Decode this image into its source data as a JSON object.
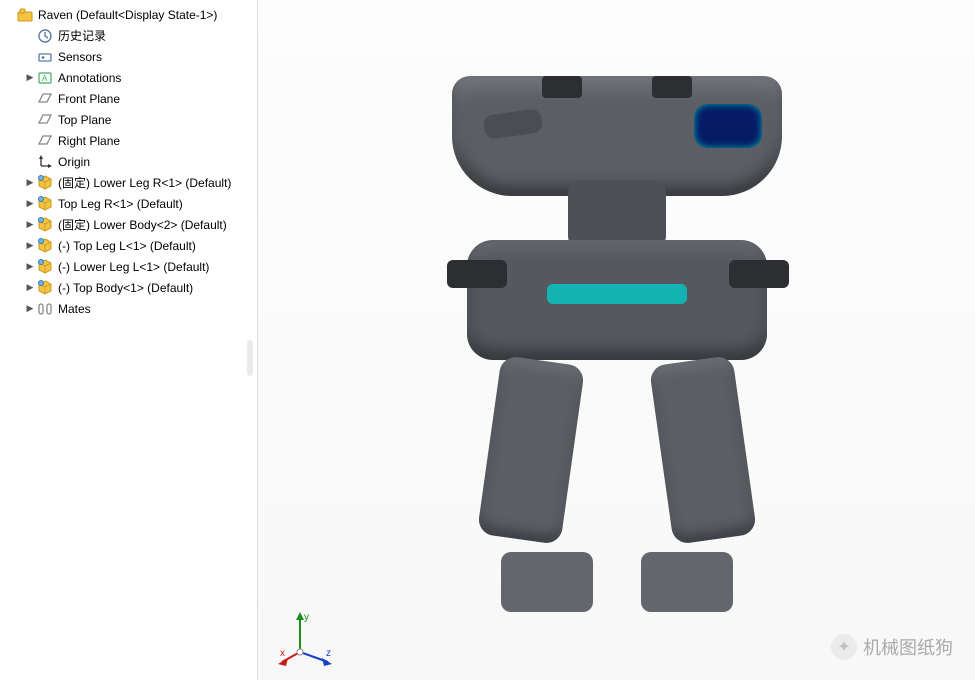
{
  "tree": {
    "root": {
      "label": "Raven  (Default<Display State-1>)"
    },
    "items": [
      {
        "label": "历史记录",
        "icon": "history-icon",
        "indent": 1,
        "arrow": ""
      },
      {
        "label": "Sensors",
        "icon": "sensor-icon",
        "indent": 1,
        "arrow": ""
      },
      {
        "label": "Annotations",
        "icon": "annotation-icon",
        "indent": 1,
        "arrow": "▶"
      },
      {
        "label": "Front Plane",
        "icon": "plane-icon",
        "indent": 1,
        "arrow": ""
      },
      {
        "label": "Top Plane",
        "icon": "plane-icon",
        "indent": 1,
        "arrow": ""
      },
      {
        "label": "Right Plane",
        "icon": "plane-icon",
        "indent": 1,
        "arrow": ""
      },
      {
        "label": "Origin",
        "icon": "origin-icon",
        "indent": 1,
        "arrow": ""
      },
      {
        "label": "(固定) Lower Leg R<1> (Default)",
        "icon": "part-icon",
        "indent": 1,
        "arrow": "▶"
      },
      {
        "label": "Top Leg R<1> (Default)",
        "icon": "part-icon",
        "indent": 1,
        "arrow": "▶"
      },
      {
        "label": "(固定) Lower Body<2> (Default)",
        "icon": "part-icon",
        "indent": 1,
        "arrow": "▶"
      },
      {
        "label": "(-) Top Leg L<1> (Default)",
        "icon": "part-icon",
        "indent": 1,
        "arrow": "▶"
      },
      {
        "label": "(-) Lower Leg L<1> (Default)",
        "icon": "part-icon",
        "indent": 1,
        "arrow": "▶"
      },
      {
        "label": "(-) Top Body<1> (Default)",
        "icon": "part-icon",
        "indent": 1,
        "arrow": "▶"
      },
      {
        "label": "Mates",
        "icon": "mates-icon",
        "indent": 1,
        "arrow": "▶"
      }
    ]
  },
  "triad": {
    "x": "x",
    "y": "y",
    "z": "z"
  },
  "watermark": {
    "text": "机械图纸狗"
  }
}
